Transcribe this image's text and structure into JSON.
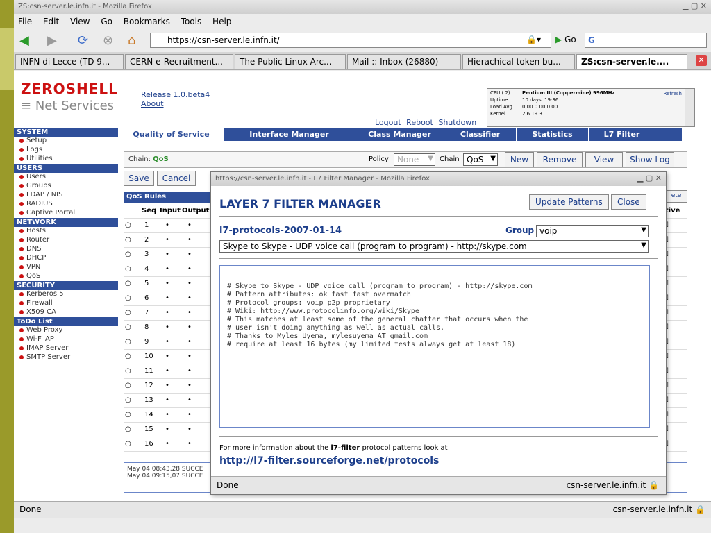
{
  "browser": {
    "window_title": "ZS:csn-server.le.infn.it - Mozilla Firefox",
    "menu": [
      "File",
      "Edit",
      "View",
      "Go",
      "Bookmarks",
      "Tools",
      "Help"
    ],
    "url": "https://csn-server.le.infn.it/",
    "go_label": "Go",
    "tabs": [
      "INFN di Lecce (TD 9...",
      "CERN e-Recruitment...",
      "The Public Linux Arc...",
      "Mail :: Inbox (26880)",
      "Hierachical token bu...",
      "ZS:csn-server.le...."
    ],
    "status_left": "Done",
    "status_right": "csn-server.le.infn.it"
  },
  "header": {
    "logo_top": "ZEROSHELL",
    "logo_bottom": "Net Services",
    "release": "Release 1.0.beta4",
    "about": "About",
    "links": [
      "Logout",
      "Reboot",
      "Shutdown"
    ],
    "sysinfo": {
      "cpu_label": "CPU ( 2)",
      "cpu_value": "Pentium III (Coppermine) 996MHz",
      "uptime_label": "Uptime",
      "uptime_value": "10 days, 19:36",
      "load_label": "Load Avg",
      "load_value": "0.00 0.00 0.00",
      "kernel_label": "Kernel",
      "kernel_value": "2.6.19.3",
      "refresh": "Refresh"
    }
  },
  "sidebar": {
    "sections": [
      {
        "title": "SYSTEM",
        "items": [
          "Setup",
          "Logs",
          "Utilities"
        ]
      },
      {
        "title": "USERS",
        "items": [
          "Users",
          "Groups",
          "LDAP / NIS",
          "RADIUS",
          "Captive Portal"
        ]
      },
      {
        "title": "NETWORK",
        "items": [
          "Hosts",
          "Router",
          "DNS",
          "DHCP",
          "VPN",
          "QoS"
        ]
      },
      {
        "title": "SECURITY",
        "items": [
          "Kerberos 5",
          "Firewall",
          "X509 CA"
        ]
      },
      {
        "title": "ToDo List",
        "items": [
          "Web Proxy",
          "Wi-Fi AP",
          "IMAP Server",
          "SMTP Server"
        ]
      }
    ]
  },
  "navtabs": [
    "Quality of Service",
    "Interface Manager",
    "Class Manager",
    "Classifier",
    "Statistics",
    "L7 Filter"
  ],
  "content": {
    "chain_label": "Chain:",
    "chain_value": "QoS",
    "policy_label": "Policy",
    "policy_value": "None",
    "chain2_label": "Chain",
    "chain2_value": "QoS",
    "buttons": [
      "New",
      "Remove",
      "View",
      "Show Log"
    ],
    "save": "Save",
    "cancel": "Cancel",
    "qos_rules": "QoS Rules",
    "cols": [
      "Seq",
      "Input",
      "Output"
    ],
    "active_col": "ctive",
    "delete_btn": "ete",
    "rows": [
      "1",
      "2",
      "3",
      "4",
      "5",
      "6",
      "7",
      "8",
      "9",
      "10",
      "11",
      "12",
      "13",
      "14",
      "15",
      "16"
    ],
    "logs": [
      "May 04 08:43,28 SUCCE",
      "May 04 09:15,07 SUCCE"
    ]
  },
  "popup": {
    "title": "https://csn-server.le.infn.it - L7 Filter Manager - Mozilla Firefox",
    "heading": "LAYER 7 FILTER MANAGER",
    "update_btn": "Update Patterns",
    "close_btn": "Close",
    "version": "l7-protocols-2007-01-14",
    "group_label": "Group",
    "group_value": "voip",
    "protocol_value": "Skype to Skype - UDP voice call (program to program) - http://skype.com",
    "code_lines": [
      "# Skype to Skype - UDP voice call (program to program) - http://skype.com",
      "# Pattern attributes: ok fast fast overmatch",
      "# Protocol groups: voip p2p proprietary",
      "# Wiki: http://www.protocolinfo.org/wiki/Skype",
      "# This matches at least some of the general chatter that occurs when the",
      "# user isn't doing anything as well as actual calls.",
      "# Thanks to Myles Uyema, mylesuyema AT gmail.com",
      "# require at least 16 bytes (my limited tests always get at least 18)"
    ],
    "info_pre": "For more information about the ",
    "info_bold": "l7-filter",
    "info_post": " protocol patterns look at",
    "link": "http://l7-filter.sourceforge.net/protocols",
    "status_left": "Done",
    "status_right": "csn-server.le.infn.it"
  }
}
